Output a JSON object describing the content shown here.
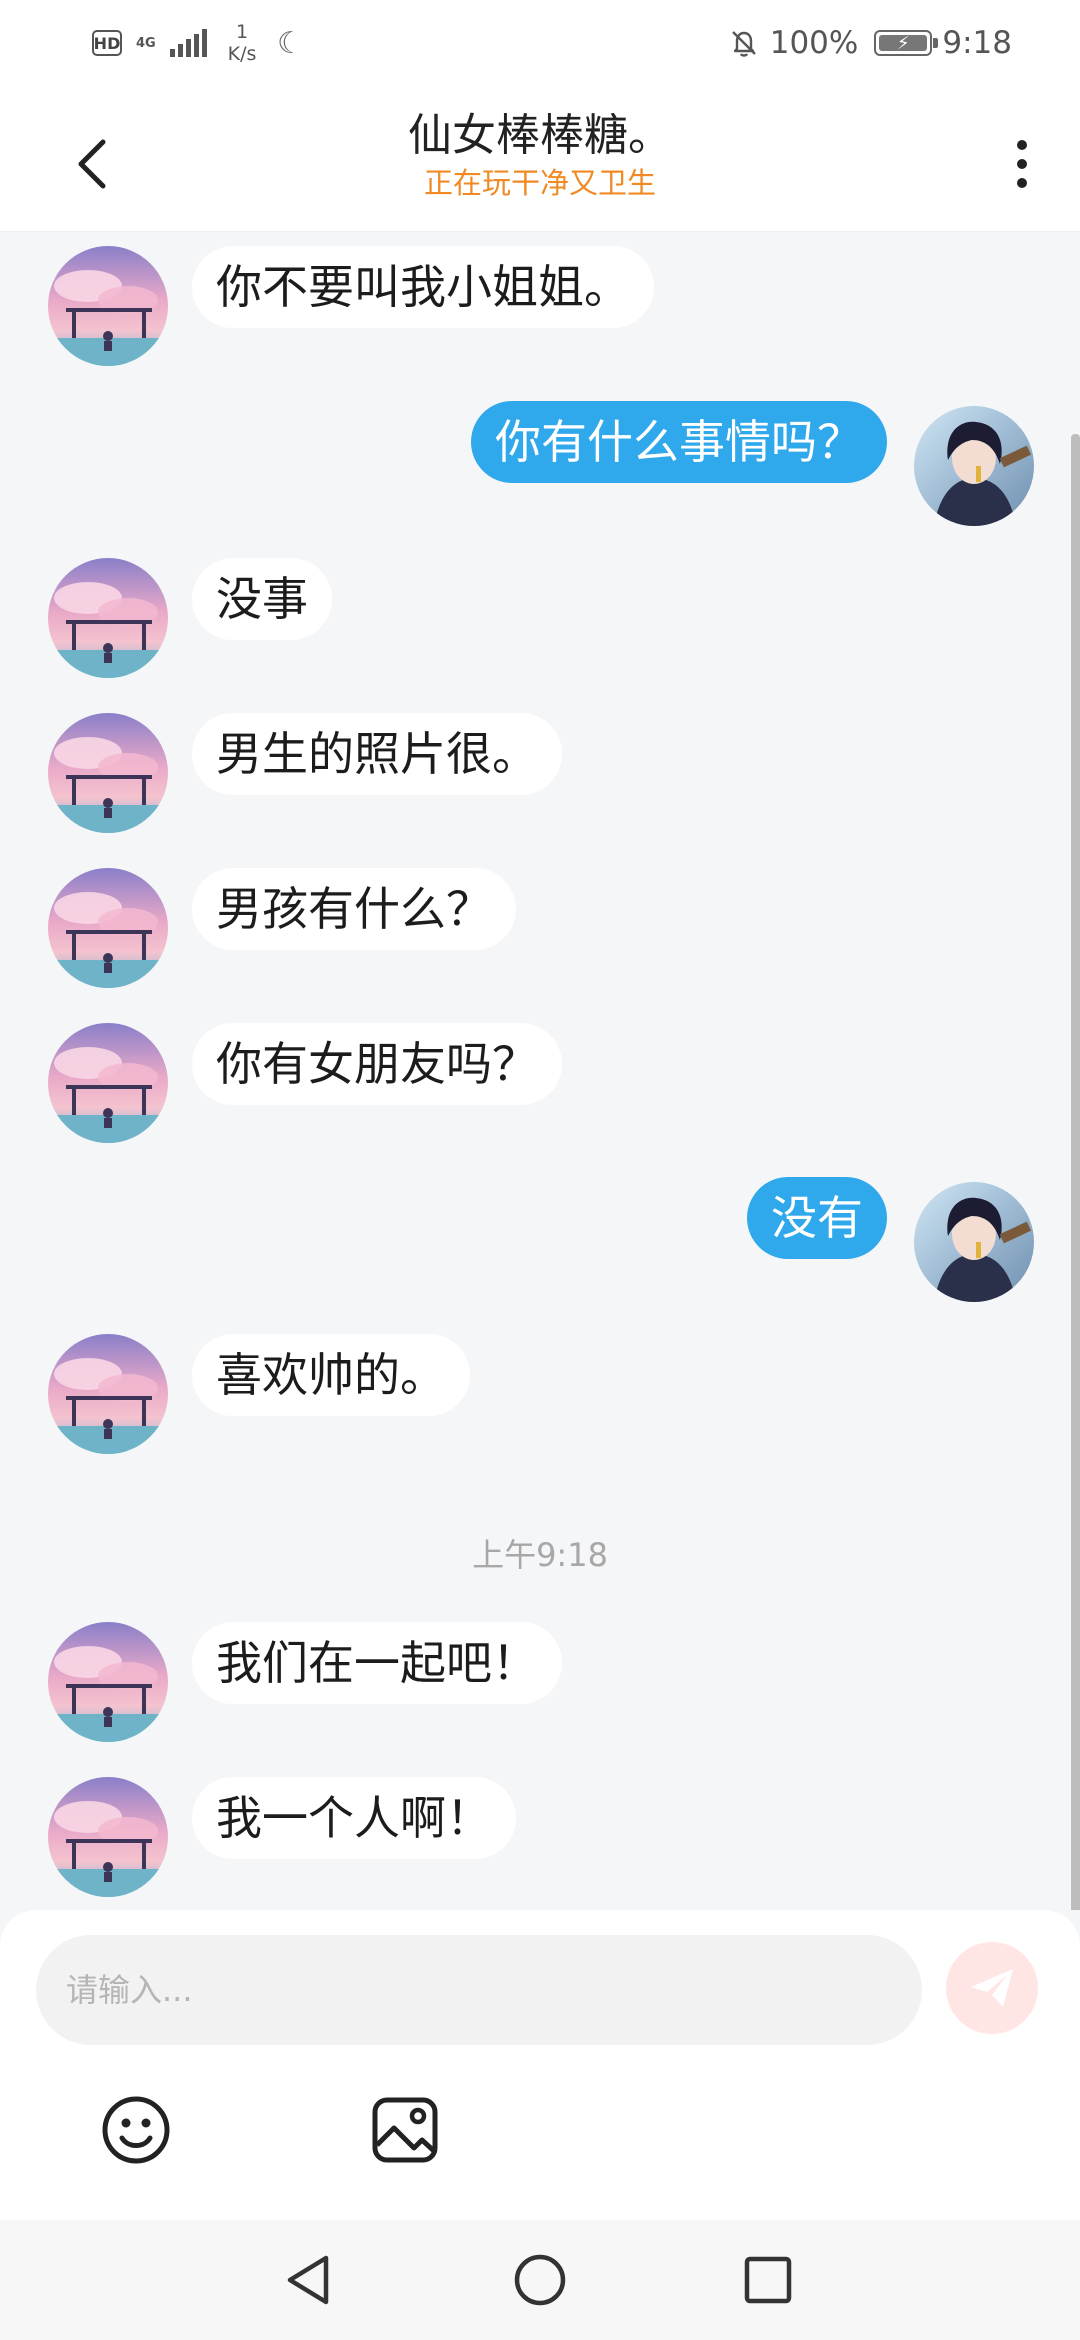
{
  "status_bar": {
    "hd": "HD",
    "network": "4G",
    "speed_value": "1",
    "speed_unit": "K/s",
    "battery": "100%",
    "time": "9:18"
  },
  "header": {
    "title": "仙女棒棒糖。",
    "status": "正在玩干净又卫生"
  },
  "messages": [
    {
      "sender": "other",
      "text": "你不要叫我小姐姐。"
    },
    {
      "sender": "me",
      "text": "你有什么事情吗？"
    },
    {
      "sender": "other",
      "text": "没事"
    },
    {
      "sender": "other",
      "text": "男生的照片很。"
    },
    {
      "sender": "other",
      "text": "男孩有什么？"
    },
    {
      "sender": "other",
      "text": "你有女朋友吗？"
    },
    {
      "sender": "me",
      "text": "没有"
    },
    {
      "sender": "other",
      "text": "喜欢帅的。"
    },
    {
      "sender": "other",
      "text": "我们在一起吧！"
    },
    {
      "sender": "other",
      "text": "我一个人啊！"
    }
  ],
  "timestamp": "上午9:18",
  "input": {
    "placeholder": "请输入...",
    "value": ""
  },
  "icons": {
    "back": "chevron-left-icon",
    "more": "more-vertical-icon",
    "send": "paper-plane-icon",
    "emoji": "smiley-icon",
    "image": "image-icon"
  },
  "colors": {
    "my_bubble": "#2fa8ec",
    "their_bubble": "#ffffff",
    "status_text": "#f08a24",
    "send_button": "#ffe5e3",
    "background": "#f5f6f8"
  }
}
